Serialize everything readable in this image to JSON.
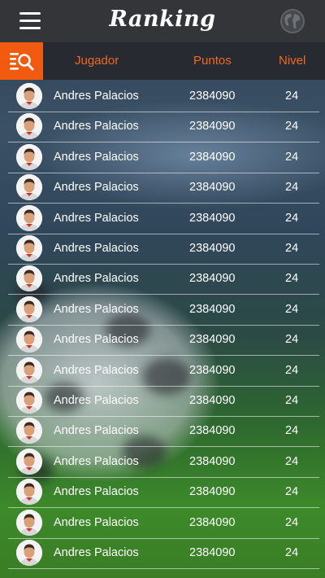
{
  "header": {
    "title": "Ranking"
  },
  "table": {
    "columns": {
      "player": "Jugador",
      "points": "Puntos",
      "level": "Nivel"
    },
    "rows": [
      {
        "name": "Andres Palacios",
        "points": "2384090",
        "level": "24"
      },
      {
        "name": "Andres Palacios",
        "points": "2384090",
        "level": "24"
      },
      {
        "name": "Andres Palacios",
        "points": "2384090",
        "level": "24"
      },
      {
        "name": "Andres Palacios",
        "points": "2384090",
        "level": "24"
      },
      {
        "name": "Andres Palacios",
        "points": "2384090",
        "level": "24"
      },
      {
        "name": "Andres Palacios",
        "points": "2384090",
        "level": "24"
      },
      {
        "name": "Andres Palacios",
        "points": "2384090",
        "level": "24"
      },
      {
        "name": "Andres Palacios",
        "points": "2384090",
        "level": "24"
      },
      {
        "name": "Andres Palacios",
        "points": "2384090",
        "level": "24"
      },
      {
        "name": "Andres Palacios",
        "points": "2384090",
        "level": "24"
      },
      {
        "name": "Andres Palacios",
        "points": "2384090",
        "level": "24"
      },
      {
        "name": "Andres Palacios",
        "points": "2384090",
        "level": "24"
      },
      {
        "name": "Andres Palacios",
        "points": "2384090",
        "level": "24"
      },
      {
        "name": "Andres Palacios",
        "points": "2384090",
        "level": "24"
      },
      {
        "name": "Andres Palacios",
        "points": "2384090",
        "level": "24"
      },
      {
        "name": "Andres Palacios",
        "points": "2384090",
        "level": "24"
      }
    ]
  },
  "icons": {
    "menu": "hamburger-menu-icon",
    "globe": "globe-icon",
    "search": "search-list-icon"
  },
  "colors": {
    "accent": "#f25a10",
    "header_text": "#f0691e",
    "topbar": "#333538"
  }
}
